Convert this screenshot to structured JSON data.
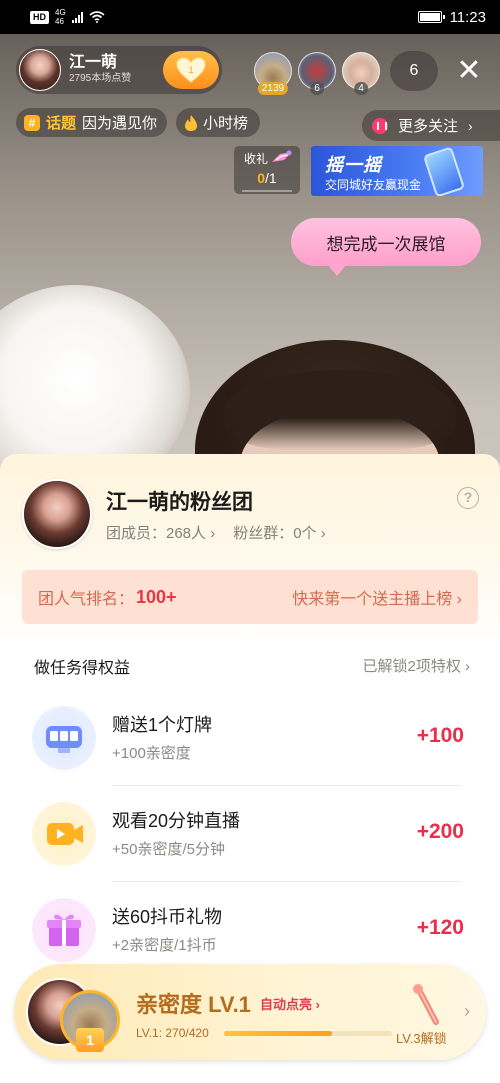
{
  "status_bar": {
    "hd": "HD",
    "network": "4G",
    "network_sub": "46",
    "time": "11:23"
  },
  "host": {
    "name": "江一萌",
    "likes": "2795本场点赞",
    "heart_level": "1"
  },
  "viewers": {
    "top": [
      {
        "badge": "2139"
      },
      {
        "badge": "6"
      },
      {
        "badge": "4"
      }
    ],
    "count": "6"
  },
  "tags": {
    "topic_hash": "#",
    "topic_word": "话题",
    "topic_name": "因为遇见你",
    "rank": "小时榜"
  },
  "more_follow": "更多关注",
  "gift_collect": {
    "label": "收礼",
    "current": "0",
    "total": "/1"
  },
  "banner": {
    "title": "摇一摇",
    "subtitle": "交同城好友赢现金"
  },
  "bubble_text": "想完成一次展馆",
  "fan_club": {
    "title": "江一萌的粉丝团",
    "members": "团成员：268人",
    "groups": "粉丝群：0个",
    "help": "?",
    "rank_label": "团人气排名：",
    "rank_value": "100+",
    "rank_cta": "快来第一个送主播上榜",
    "tasks_heading": "做任务得权益",
    "unlocked": "已解锁2项特权",
    "tasks": [
      {
        "title": "赠送1个灯牌",
        "desc": "+100亲密度",
        "reward": "+100",
        "icon": "light-sign-icon"
      },
      {
        "title": "观看20分钟直播",
        "desc": "+50亲密度/5分钟",
        "reward": "+200",
        "icon": "video-camera-icon"
      },
      {
        "title": "送60抖币礼物",
        "desc": "+2亲密度/1抖币",
        "reward": "+120",
        "icon": "gift-box-icon"
      }
    ]
  },
  "intimacy": {
    "level_badge": "1",
    "title": "亲密度 LV.1",
    "auto_light": "自动点亮",
    "progress_text": "LV.1: 270/420",
    "progress_fraction": 0.643,
    "next_unlock": "LV.3解锁"
  },
  "colors": {
    "accent_red": "#e8304d",
    "gold": "#ffb41f",
    "banner_blue": "#2b56d8",
    "bubble_pink": "#ffa5cf"
  }
}
